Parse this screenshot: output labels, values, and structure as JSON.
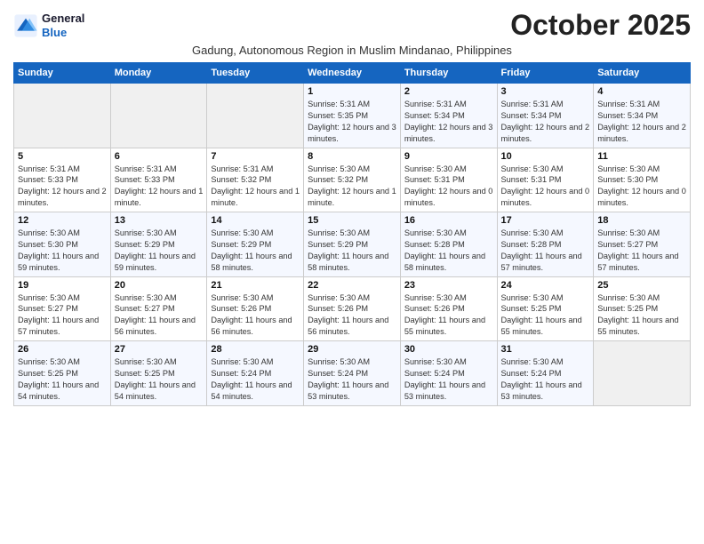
{
  "header": {
    "logo_line1": "General",
    "logo_line2": "Blue",
    "month_title": "October 2025",
    "subtitle": "Gadung, Autonomous Region in Muslim Mindanao, Philippines"
  },
  "days_of_week": [
    "Sunday",
    "Monday",
    "Tuesday",
    "Wednesday",
    "Thursday",
    "Friday",
    "Saturday"
  ],
  "weeks": [
    [
      {
        "day": "",
        "info": ""
      },
      {
        "day": "",
        "info": ""
      },
      {
        "day": "",
        "info": ""
      },
      {
        "day": "1",
        "info": "Sunrise: 5:31 AM\nSunset: 5:35 PM\nDaylight: 12 hours and 3 minutes."
      },
      {
        "day": "2",
        "info": "Sunrise: 5:31 AM\nSunset: 5:34 PM\nDaylight: 12 hours and 3 minutes."
      },
      {
        "day": "3",
        "info": "Sunrise: 5:31 AM\nSunset: 5:34 PM\nDaylight: 12 hours and 2 minutes."
      },
      {
        "day": "4",
        "info": "Sunrise: 5:31 AM\nSunset: 5:34 PM\nDaylight: 12 hours and 2 minutes."
      }
    ],
    [
      {
        "day": "5",
        "info": "Sunrise: 5:31 AM\nSunset: 5:33 PM\nDaylight: 12 hours and 2 minutes."
      },
      {
        "day": "6",
        "info": "Sunrise: 5:31 AM\nSunset: 5:33 PM\nDaylight: 12 hours and 1 minute."
      },
      {
        "day": "7",
        "info": "Sunrise: 5:31 AM\nSunset: 5:32 PM\nDaylight: 12 hours and 1 minute."
      },
      {
        "day": "8",
        "info": "Sunrise: 5:30 AM\nSunset: 5:32 PM\nDaylight: 12 hours and 1 minute."
      },
      {
        "day": "9",
        "info": "Sunrise: 5:30 AM\nSunset: 5:31 PM\nDaylight: 12 hours and 0 minutes."
      },
      {
        "day": "10",
        "info": "Sunrise: 5:30 AM\nSunset: 5:31 PM\nDaylight: 12 hours and 0 minutes."
      },
      {
        "day": "11",
        "info": "Sunrise: 5:30 AM\nSunset: 5:30 PM\nDaylight: 12 hours and 0 minutes."
      }
    ],
    [
      {
        "day": "12",
        "info": "Sunrise: 5:30 AM\nSunset: 5:30 PM\nDaylight: 11 hours and 59 minutes."
      },
      {
        "day": "13",
        "info": "Sunrise: 5:30 AM\nSunset: 5:29 PM\nDaylight: 11 hours and 59 minutes."
      },
      {
        "day": "14",
        "info": "Sunrise: 5:30 AM\nSunset: 5:29 PM\nDaylight: 11 hours and 58 minutes."
      },
      {
        "day": "15",
        "info": "Sunrise: 5:30 AM\nSunset: 5:29 PM\nDaylight: 11 hours and 58 minutes."
      },
      {
        "day": "16",
        "info": "Sunrise: 5:30 AM\nSunset: 5:28 PM\nDaylight: 11 hours and 58 minutes."
      },
      {
        "day": "17",
        "info": "Sunrise: 5:30 AM\nSunset: 5:28 PM\nDaylight: 11 hours and 57 minutes."
      },
      {
        "day": "18",
        "info": "Sunrise: 5:30 AM\nSunset: 5:27 PM\nDaylight: 11 hours and 57 minutes."
      }
    ],
    [
      {
        "day": "19",
        "info": "Sunrise: 5:30 AM\nSunset: 5:27 PM\nDaylight: 11 hours and 57 minutes."
      },
      {
        "day": "20",
        "info": "Sunrise: 5:30 AM\nSunset: 5:27 PM\nDaylight: 11 hours and 56 minutes."
      },
      {
        "day": "21",
        "info": "Sunrise: 5:30 AM\nSunset: 5:26 PM\nDaylight: 11 hours and 56 minutes."
      },
      {
        "day": "22",
        "info": "Sunrise: 5:30 AM\nSunset: 5:26 PM\nDaylight: 11 hours and 56 minutes."
      },
      {
        "day": "23",
        "info": "Sunrise: 5:30 AM\nSunset: 5:26 PM\nDaylight: 11 hours and 55 minutes."
      },
      {
        "day": "24",
        "info": "Sunrise: 5:30 AM\nSunset: 5:25 PM\nDaylight: 11 hours and 55 minutes."
      },
      {
        "day": "25",
        "info": "Sunrise: 5:30 AM\nSunset: 5:25 PM\nDaylight: 11 hours and 55 minutes."
      }
    ],
    [
      {
        "day": "26",
        "info": "Sunrise: 5:30 AM\nSunset: 5:25 PM\nDaylight: 11 hours and 54 minutes."
      },
      {
        "day": "27",
        "info": "Sunrise: 5:30 AM\nSunset: 5:25 PM\nDaylight: 11 hours and 54 minutes."
      },
      {
        "day": "28",
        "info": "Sunrise: 5:30 AM\nSunset: 5:24 PM\nDaylight: 11 hours and 54 minutes."
      },
      {
        "day": "29",
        "info": "Sunrise: 5:30 AM\nSunset: 5:24 PM\nDaylight: 11 hours and 53 minutes."
      },
      {
        "day": "30",
        "info": "Sunrise: 5:30 AM\nSunset: 5:24 PM\nDaylight: 11 hours and 53 minutes."
      },
      {
        "day": "31",
        "info": "Sunrise: 5:30 AM\nSunset: 5:24 PM\nDaylight: 11 hours and 53 minutes."
      },
      {
        "day": "",
        "info": ""
      }
    ]
  ]
}
